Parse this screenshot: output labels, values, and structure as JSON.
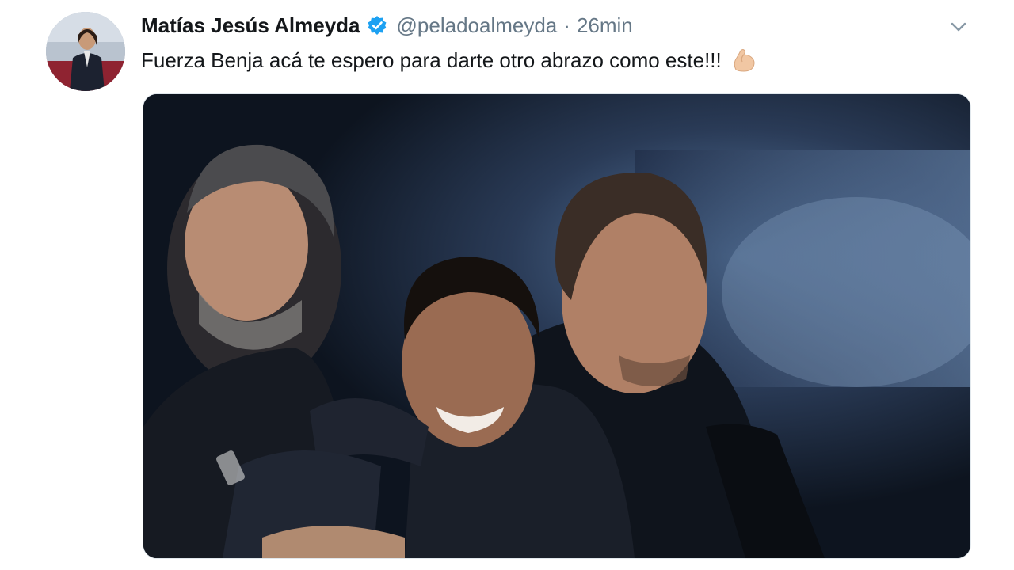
{
  "tweet": {
    "author_name": "Matías Jesús Almeyda",
    "verified": true,
    "handle": "@peladoalmeyda",
    "separator": "·",
    "time": "26min",
    "text": "Fuerza Benja acá te espero para darte otro abrazo como este!!!",
    "emoji": "flexed-biceps-icon",
    "caret_icon": "chevron-down-icon",
    "media_icon": "photo"
  },
  "colors": {
    "text": "#14171a",
    "secondary": "#657786",
    "verified": "#1da1f2",
    "border": "#e1e8ed"
  }
}
